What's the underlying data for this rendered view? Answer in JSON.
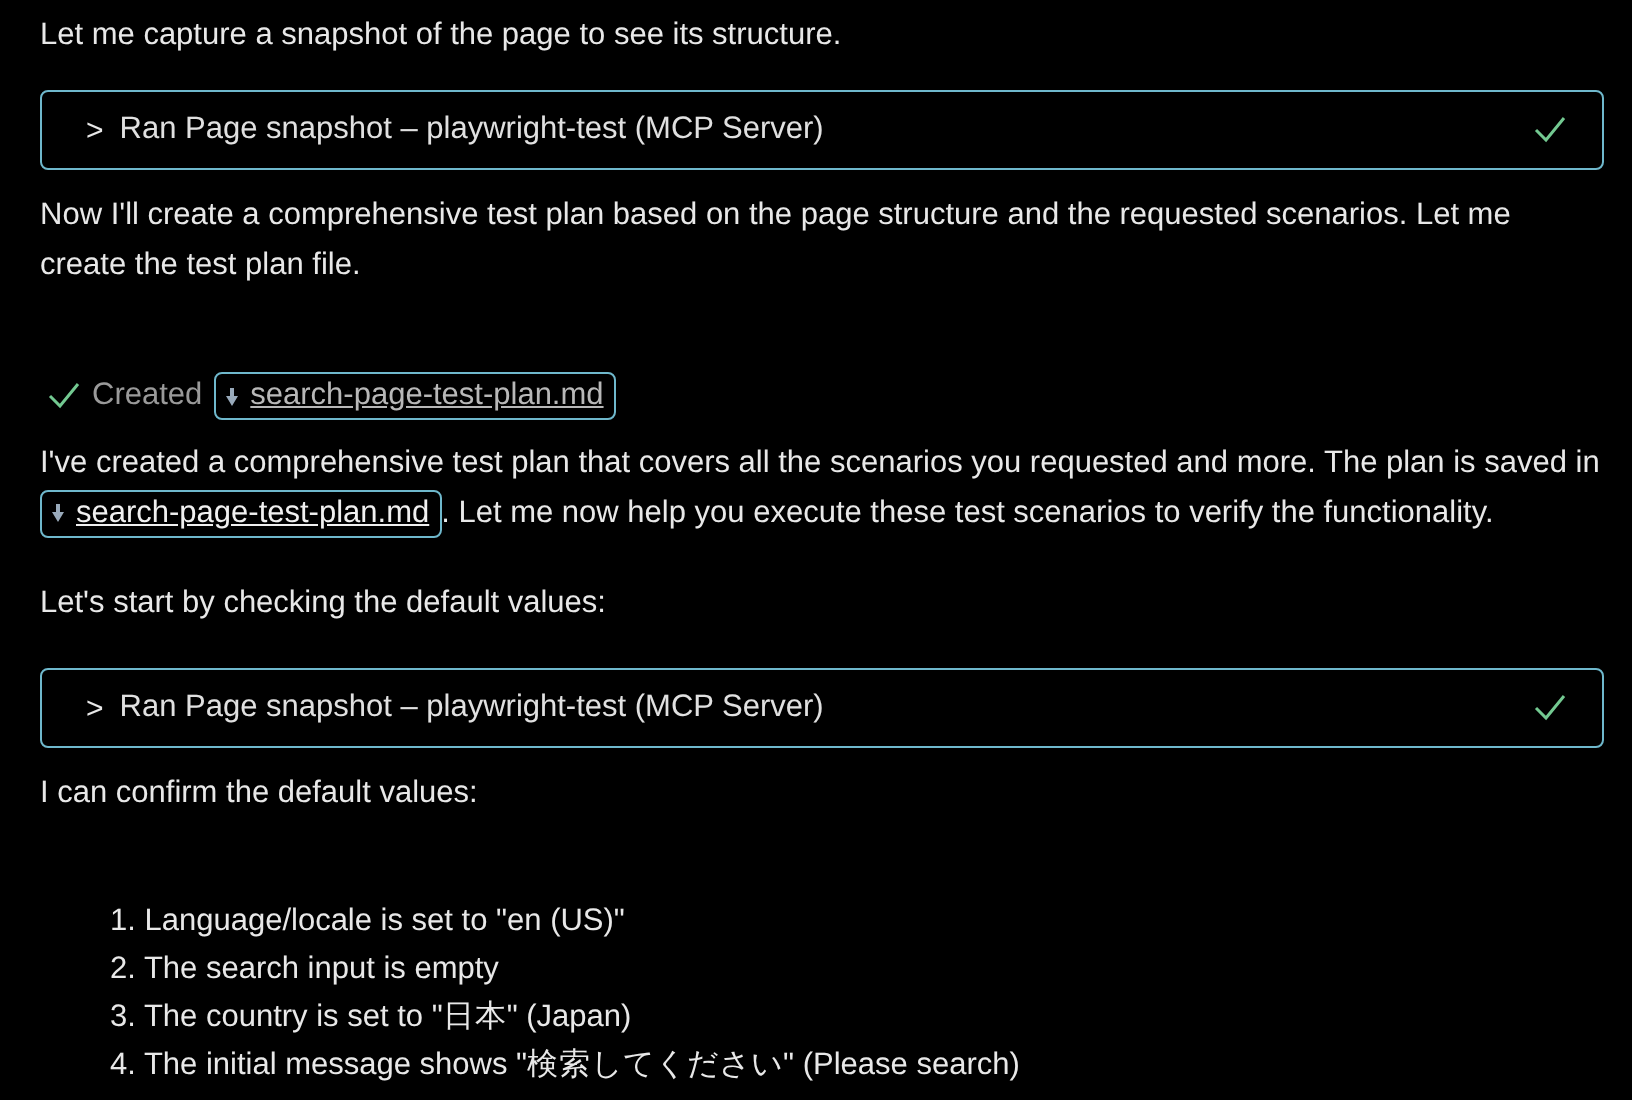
{
  "messages": [
    {
      "kind": "paragraph",
      "text": "Let me capture a snapshot of the page to see its structure."
    },
    {
      "kind": "tool",
      "chevron": ">",
      "label": "Ran Page snapshot – playwright-test (MCP Server)",
      "done": true
    },
    {
      "kind": "paragraph",
      "text": "Now I'll create a comprehensive test plan based on the page structure and the requested scenarios. Let me create the test plan file."
    },
    {
      "kind": "created",
      "label": "Created",
      "file": "search-page-test-plan.md",
      "done": true
    },
    {
      "kind": "linked",
      "before": "I've created a comprehensive test plan that covers all the scenarios you requested and more. The plan is saved in",
      "file": "search-page-test-plan.md",
      "after": ". Let me now help you execute these test scenarios to verify the functionality."
    },
    {
      "kind": "paragraph",
      "text": "Let's start by checking the default values:"
    },
    {
      "kind": "tool",
      "chevron": ">",
      "label": "Ran Page snapshot – playwright-test (MCP Server)",
      "done": true
    },
    {
      "kind": "paragraph",
      "text": "I can confirm the default values:"
    },
    {
      "kind": "list",
      "items": [
        "1. Language/locale is set to \"en (US)\"",
        "2. The search input is empty",
        "3. The country is set to \"日本\" (Japan)",
        "4. The initial message shows \"検索してください\" (Please search)"
      ]
    }
  ]
}
